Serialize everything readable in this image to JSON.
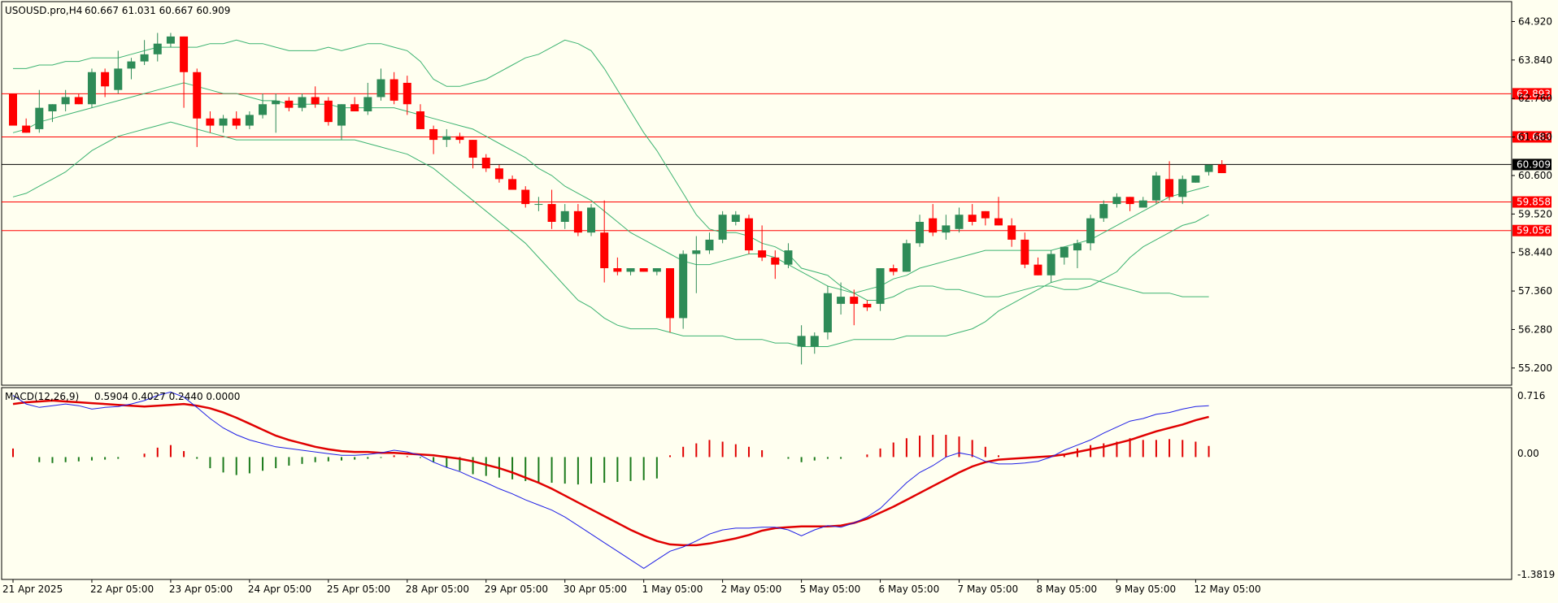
{
  "header": {
    "symbol_tf": "USOUSD.pro,H4",
    "ohlc_text": "60.667 61.031 60.667 60.909"
  },
  "macd": {
    "label": "MACD(12,26,9)",
    "values_text": "0.5904 0.4027 0.2440 0.0000",
    "axis": {
      "top": "0.716",
      "zero": "0.00",
      "bottom": "-1.3819"
    }
  },
  "colors": {
    "background": "#fffff0",
    "bull_candle": "#2e8b57",
    "bear_candle": "#ff0000",
    "bollinger": "#3cb371",
    "level_line": "#ff0000",
    "current_line": "#000000",
    "macd_signal": "#e00000",
    "macd_main": "#1e1ee6",
    "hist_pos": "#e00000",
    "hist_neg": "#1a7a1a"
  },
  "chart_data": [
    {
      "type": "candlestick",
      "ylim": [
        54.9,
        65.25
      ],
      "price_ticks": [
        "64.920",
        "63.840",
        "62.760",
        "61.680",
        "60.600",
        "59.520",
        "58.440",
        "57.360",
        "56.280",
        "55.200"
      ],
      "price_tick_values": [
        64.92,
        63.84,
        62.76,
        61.68,
        60.6,
        59.52,
        58.44,
        57.36,
        56.28,
        55.2
      ],
      "levels": [
        {
          "label": "62.893",
          "value": 62.893
        },
        {
          "label": "61.683",
          "value": 61.683
        },
        {
          "label": "59.858",
          "value": 59.858
        },
        {
          "label": "59.056",
          "value": 59.056
        }
      ],
      "current": {
        "label": "60.909",
        "value": 60.909
      },
      "x_labels": [
        "21 Apr 2025",
        "22 Apr 05:00",
        "23 Apr 05:00",
        "24 Apr 05:00",
        "25 Apr 05:00",
        "28 Apr 05:00",
        "29 Apr 05:00",
        "30 Apr 05:00",
        "1 May 05:00",
        "2 May 05:00",
        "5 May 05:00",
        "6 May 05:00",
        "7 May 05:00",
        "8 May 05:00",
        "9 May 05:00",
        "12 May 05:00"
      ],
      "x_label_bars": [
        0,
        6,
        12,
        18,
        24,
        30,
        36,
        42,
        48,
        54,
        60,
        66,
        72,
        78,
        84,
        90
      ],
      "candles": [
        [
          62.9,
          62.9,
          62.0,
          62.0
        ],
        [
          62.0,
          62.2,
          61.8,
          61.8
        ],
        [
          61.9,
          63.0,
          61.8,
          62.5
        ],
        [
          62.4,
          62.6,
          62.1,
          62.6
        ],
        [
          62.6,
          63.0,
          62.4,
          62.8
        ],
        [
          62.8,
          62.9,
          62.6,
          62.6
        ],
        [
          62.6,
          63.6,
          62.5,
          63.5
        ],
        [
          63.5,
          63.6,
          62.8,
          63.1
        ],
        [
          63.0,
          64.1,
          62.9,
          63.6
        ],
        [
          63.6,
          63.9,
          63.3,
          63.8
        ],
        [
          63.8,
          64.4,
          63.7,
          64.0
        ],
        [
          64.0,
          64.6,
          63.8,
          64.3
        ],
        [
          64.3,
          64.6,
          64.2,
          64.5
        ],
        [
          64.5,
          64.5,
          62.5,
          63.5
        ],
        [
          63.5,
          63.6,
          61.4,
          62.2
        ],
        [
          62.2,
          62.4,
          61.8,
          62.0
        ],
        [
          62.0,
          62.3,
          61.8,
          62.2
        ],
        [
          62.2,
          62.4,
          61.9,
          62.0
        ],
        [
          62.0,
          62.4,
          61.9,
          62.3
        ],
        [
          62.3,
          62.9,
          62.2,
          62.6
        ],
        [
          62.6,
          62.9,
          61.8,
          62.7
        ],
        [
          62.7,
          62.8,
          62.4,
          62.5
        ],
        [
          62.5,
          62.9,
          62.4,
          62.8
        ],
        [
          62.8,
          63.1,
          62.5,
          62.6
        ],
        [
          62.7,
          62.8,
          62.0,
          62.1
        ],
        [
          62.0,
          62.6,
          61.6,
          62.6
        ],
        [
          62.6,
          62.8,
          62.4,
          62.4
        ],
        [
          62.4,
          63.2,
          62.3,
          62.8
        ],
        [
          62.8,
          63.6,
          62.7,
          63.3
        ],
        [
          63.3,
          63.5,
          62.6,
          62.7
        ],
        [
          63.2,
          63.4,
          62.3,
          62.6
        ],
        [
          62.4,
          62.6,
          61.9,
          61.9
        ],
        [
          61.9,
          62.0,
          61.2,
          61.6
        ],
        [
          61.6,
          61.9,
          61.4,
          61.7
        ],
        [
          61.7,
          61.8,
          61.5,
          61.6
        ],
        [
          61.6,
          61.6,
          60.8,
          61.1
        ],
        [
          61.1,
          61.2,
          60.7,
          60.8
        ],
        [
          60.8,
          60.9,
          60.4,
          60.5
        ],
        [
          60.5,
          60.6,
          60.2,
          60.2
        ],
        [
          60.2,
          60.3,
          59.7,
          59.8
        ],
        [
          59.8,
          60.0,
          59.6,
          59.8
        ],
        [
          59.8,
          60.2,
          59.1,
          59.3
        ],
        [
          59.3,
          59.8,
          59.1,
          59.6
        ],
        [
          59.6,
          59.8,
          58.9,
          59.0
        ],
        [
          59.0,
          59.8,
          58.9,
          59.7
        ],
        [
          59.0,
          59.9,
          57.6,
          58.0
        ],
        [
          58.0,
          58.3,
          57.8,
          57.9
        ],
        [
          57.9,
          58.0,
          57.8,
          58.0
        ],
        [
          58.0,
          58.0,
          57.9,
          57.9
        ],
        [
          57.9,
          58.0,
          57.8,
          58.0
        ],
        [
          58.0,
          58.0,
          56.2,
          56.6
        ],
        [
          56.6,
          58.5,
          56.3,
          58.4
        ],
        [
          58.4,
          58.9,
          57.3,
          58.5
        ],
        [
          58.5,
          59.0,
          58.4,
          58.8
        ],
        [
          58.8,
          59.6,
          58.7,
          59.5
        ],
        [
          59.3,
          59.6,
          59.2,
          59.5
        ],
        [
          59.4,
          59.5,
          58.4,
          58.5
        ],
        [
          58.5,
          59.2,
          58.2,
          58.3
        ],
        [
          58.3,
          58.5,
          57.7,
          58.1
        ],
        [
          58.1,
          58.7,
          58.0,
          58.5
        ],
        [
          55.8,
          56.4,
          55.3,
          56.1
        ],
        [
          55.8,
          56.2,
          55.6,
          56.1
        ],
        [
          56.2,
          57.5,
          56.0,
          57.3
        ],
        [
          57.0,
          57.6,
          56.7,
          57.2
        ],
        [
          57.2,
          57.4,
          56.4,
          57.0
        ],
        [
          57.0,
          57.1,
          56.8,
          56.9
        ],
        [
          57.0,
          58.0,
          56.8,
          58.0
        ],
        [
          58.0,
          58.1,
          57.8,
          57.9
        ],
        [
          57.9,
          58.8,
          57.9,
          58.7
        ],
        [
          58.7,
          59.5,
          58.6,
          59.3
        ],
        [
          59.4,
          59.8,
          58.9,
          59.0
        ],
        [
          59.0,
          59.5,
          58.8,
          59.2
        ],
        [
          59.1,
          59.7,
          59.0,
          59.5
        ],
        [
          59.5,
          59.8,
          59.2,
          59.3
        ],
        [
          59.6,
          59.6,
          59.2,
          59.4
        ],
        [
          59.4,
          60.0,
          59.2,
          59.2
        ],
        [
          59.2,
          59.4,
          58.6,
          58.8
        ],
        [
          58.8,
          59.0,
          58.0,
          58.1
        ],
        [
          58.1,
          58.3,
          57.8,
          57.8
        ],
        [
          57.8,
          58.5,
          57.6,
          58.4
        ],
        [
          58.3,
          58.6,
          58.1,
          58.6
        ],
        [
          58.5,
          58.8,
          58.0,
          58.7
        ],
        [
          58.7,
          59.5,
          58.5,
          59.4
        ],
        [
          59.4,
          59.9,
          59.3,
          59.8
        ],
        [
          59.8,
          60.1,
          59.7,
          60.0
        ],
        [
          60.0,
          60.0,
          59.6,
          59.8
        ],
        [
          59.7,
          60.0,
          59.7,
          59.9
        ],
        [
          59.9,
          60.7,
          59.8,
          60.6
        ],
        [
          60.5,
          61.0,
          59.9,
          60.0
        ],
        [
          60.0,
          60.6,
          59.8,
          60.5
        ],
        [
          60.4,
          60.6,
          60.4,
          60.6
        ],
        [
          60.7,
          60.9,
          60.6,
          60.9
        ],
        [
          60.909,
          61.031,
          60.667,
          60.667
        ]
      ],
      "bollinger_upper": [
        63.6,
        63.6,
        63.7,
        63.7,
        63.8,
        63.8,
        63.9,
        63.9,
        63.9,
        64.0,
        64.1,
        64.2,
        64.2,
        64.2,
        64.2,
        64.3,
        64.3,
        64.4,
        64.3,
        64.3,
        64.2,
        64.1,
        64.1,
        64.1,
        64.2,
        64.1,
        64.2,
        64.3,
        64.3,
        64.2,
        64.1,
        63.8,
        63.3,
        63.1,
        63.1,
        63.2,
        63.3,
        63.5,
        63.7,
        63.9,
        64.0,
        64.2,
        64.4,
        64.3,
        64.1,
        63.6,
        63.0,
        62.4,
        61.8,
        61.3,
        60.7,
        60.1,
        59.5,
        59.1,
        59.0,
        59.0,
        58.9,
        58.7,
        58.6,
        58.4,
        58.0,
        57.9,
        57.8,
        57.5,
        57.3,
        57.1,
        57.1,
        57.2,
        57.4,
        57.5,
        57.5,
        57.4,
        57.4,
        57.3,
        57.2,
        57.2,
        57.3,
        57.4,
        57.5,
        57.5,
        57.4,
        57.4,
        57.5,
        57.7,
        57.9,
        58.3,
        58.6,
        58.8,
        59.0,
        59.2,
        59.3,
        59.5
      ],
      "bollinger_middle": [
        61.8,
        61.9,
        62.1,
        62.2,
        62.3,
        62.4,
        62.5,
        62.6,
        62.7,
        62.8,
        62.9,
        63.0,
        63.1,
        63.2,
        63.1,
        63.0,
        62.9,
        62.9,
        62.8,
        62.7,
        62.7,
        62.6,
        62.6,
        62.6,
        62.6,
        62.5,
        62.5,
        62.5,
        62.5,
        62.5,
        62.4,
        62.3,
        62.2,
        62.1,
        62.0,
        61.9,
        61.7,
        61.5,
        61.3,
        61.1,
        60.8,
        60.6,
        60.3,
        60.1,
        59.9,
        59.6,
        59.3,
        59.0,
        58.8,
        58.6,
        58.4,
        58.2,
        58.1,
        58.1,
        58.2,
        58.3,
        58.4,
        58.4,
        58.3,
        58.1,
        57.9,
        57.7,
        57.5,
        57.4,
        57.3,
        57.4,
        57.5,
        57.7,
        57.8,
        58.0,
        58.1,
        58.2,
        58.3,
        58.4,
        58.5,
        58.5,
        58.5,
        58.5,
        58.5,
        58.5,
        58.6,
        58.7,
        58.8,
        59.0,
        59.2,
        59.4,
        59.6,
        59.8,
        60.0,
        60.1,
        60.2,
        60.3
      ],
      "bollinger_lower": [
        60.0,
        60.1,
        60.3,
        60.5,
        60.7,
        61.0,
        61.3,
        61.5,
        61.7,
        61.8,
        61.9,
        62.0,
        62.1,
        62.0,
        61.9,
        61.8,
        61.7,
        61.6,
        61.6,
        61.6,
        61.6,
        61.6,
        61.6,
        61.6,
        61.6,
        61.6,
        61.6,
        61.5,
        61.4,
        61.3,
        61.2,
        61.0,
        60.8,
        60.5,
        60.2,
        59.9,
        59.6,
        59.3,
        59.0,
        58.7,
        58.3,
        57.9,
        57.5,
        57.1,
        56.9,
        56.6,
        56.4,
        56.3,
        56.3,
        56.3,
        56.2,
        56.1,
        56.1,
        56.1,
        56.1,
        56.0,
        56.0,
        56.0,
        55.9,
        55.9,
        55.8,
        55.8,
        55.8,
        55.9,
        56.0,
        56.0,
        56.0,
        56.0,
        56.1,
        56.1,
        56.1,
        56.1,
        56.2,
        56.3,
        56.5,
        56.8,
        57.0,
        57.2,
        57.4,
        57.6,
        57.7,
        57.7,
        57.7,
        57.6,
        57.5,
        57.4,
        57.3,
        57.3,
        57.3,
        57.2,
        57.2,
        57.2
      ]
    },
    {
      "type": "line",
      "ylim": [
        -1.3819,
        0.716
      ],
      "series": [
        {
          "name": "signal",
          "values": [
            0.62,
            0.64,
            0.65,
            0.66,
            0.65,
            0.64,
            0.63,
            0.62,
            0.61,
            0.6,
            0.59,
            0.6,
            0.61,
            0.62,
            0.6,
            0.57,
            0.52,
            0.46,
            0.39,
            0.32,
            0.25,
            0.2,
            0.16,
            0.12,
            0.09,
            0.07,
            0.06,
            0.06,
            0.05,
            0.05,
            0.04,
            0.03,
            0.02,
            0.0,
            -0.02,
            -0.05,
            -0.09,
            -0.13,
            -0.18,
            -0.24,
            -0.3,
            -0.37,
            -0.45,
            -0.53,
            -0.61,
            -0.69,
            -0.77,
            -0.85,
            -0.92,
            -0.98,
            -1.02,
            -1.03,
            -1.03,
            -1.01,
            -0.98,
            -0.95,
            -0.91,
            -0.86,
            -0.83,
            -0.82,
            -0.81,
            -0.81,
            -0.81,
            -0.8,
            -0.77,
            -0.72,
            -0.65,
            -0.58,
            -0.5,
            -0.42,
            -0.34,
            -0.26,
            -0.18,
            -0.11,
            -0.06,
            -0.03,
            -0.02,
            -0.01,
            0.0,
            0.01,
            0.03,
            0.06,
            0.09,
            0.12,
            0.16,
            0.2,
            0.25,
            0.3,
            0.34,
            0.38,
            0.43,
            0.47
          ]
        },
        {
          "name": "main",
          "values": [
            0.72,
            0.62,
            0.58,
            0.6,
            0.62,
            0.6,
            0.56,
            0.58,
            0.59,
            0.62,
            0.66,
            0.72,
            0.76,
            0.7,
            0.58,
            0.45,
            0.34,
            0.26,
            0.2,
            0.16,
            0.12,
            0.1,
            0.08,
            0.06,
            0.04,
            0.02,
            0.02,
            0.03,
            0.05,
            0.08,
            0.06,
            0.02,
            -0.06,
            -0.12,
            -0.17,
            -0.24,
            -0.3,
            -0.37,
            -0.43,
            -0.5,
            -0.56,
            -0.62,
            -0.7,
            -0.8,
            -0.9,
            -1.0,
            -1.1,
            -1.2,
            -1.3,
            -1.2,
            -1.1,
            -1.05,
            -0.98,
            -0.9,
            -0.85,
            -0.83,
            -0.83,
            -0.82,
            -0.82,
            -0.85,
            -0.92,
            -0.85,
            -0.8,
            -0.82,
            -0.77,
            -0.7,
            -0.6,
            -0.45,
            -0.3,
            -0.18,
            -0.1,
            0.0,
            0.05,
            0.02,
            -0.05,
            -0.08,
            -0.08,
            -0.07,
            -0.05,
            0.0,
            0.08,
            0.14,
            0.2,
            0.28,
            0.35,
            0.42,
            0.45,
            0.5,
            0.52,
            0.56,
            0.59,
            0.6
          ]
        }
      ],
      "histogram": [
        0.1,
        0.0,
        -0.06,
        -0.07,
        -0.06,
        -0.05,
        -0.04,
        -0.03,
        -0.02,
        0.0,
        0.04,
        0.11,
        0.14,
        0.07,
        -0.02,
        -0.13,
        -0.18,
        -0.21,
        -0.19,
        -0.16,
        -0.13,
        -0.1,
        -0.08,
        -0.06,
        -0.05,
        -0.04,
        -0.03,
        -0.02,
        -0.01,
        0.02,
        0.01,
        -0.01,
        -0.06,
        -0.12,
        -0.16,
        -0.2,
        -0.22,
        -0.24,
        -0.26,
        -0.28,
        -0.3,
        -0.3,
        -0.31,
        -0.32,
        -0.31,
        -0.3,
        -0.29,
        -0.28,
        -0.27,
        -0.25,
        0.02,
        0.12,
        0.16,
        0.2,
        0.18,
        0.15,
        0.12,
        0.08,
        0.0,
        -0.02,
        -0.06,
        -0.04,
        -0.02,
        -0.02,
        0.0,
        0.03,
        0.1,
        0.17,
        0.22,
        0.25,
        0.26,
        0.26,
        0.24,
        0.2,
        0.12,
        0.02,
        0.0,
        0.0,
        0.0,
        0.0,
        0.03,
        0.1,
        0.14,
        0.16,
        0.18,
        0.22,
        0.2,
        0.2,
        0.21,
        0.2,
        0.18,
        0.13
      ]
    }
  ]
}
